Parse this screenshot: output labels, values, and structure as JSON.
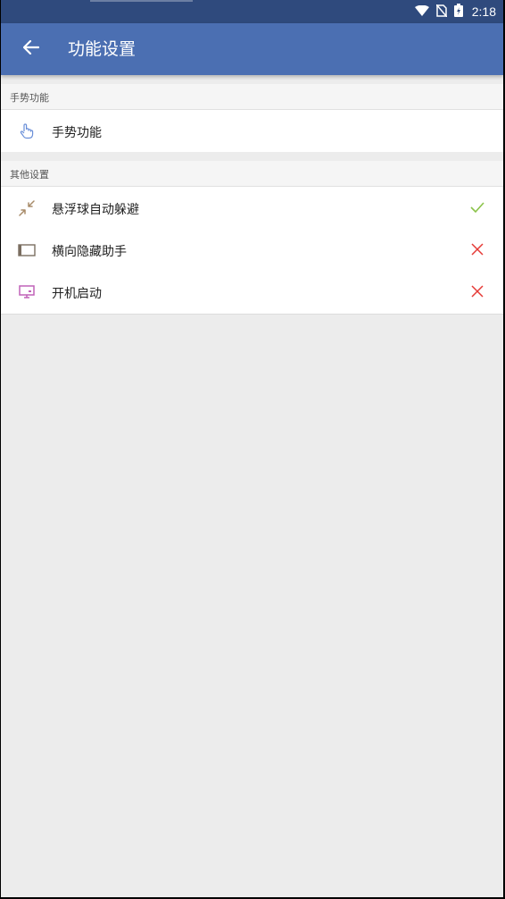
{
  "status_bar": {
    "time": "2:18"
  },
  "app_bar": {
    "title": "功能设置"
  },
  "sections": [
    {
      "header": "手势功能",
      "items": [
        {
          "label": "手势功能",
          "icon": "hand-pointer-icon"
        }
      ]
    },
    {
      "header": "其他设置",
      "items": [
        {
          "label": "悬浮球自动躲避",
          "icon": "shrink-arrows-icon",
          "status": "enabled",
          "status_icon": "check-icon"
        },
        {
          "label": "横向隐藏助手",
          "icon": "side-bar-icon",
          "status": "disabled",
          "status_icon": "cross-icon"
        },
        {
          "label": "开机启动",
          "icon": "monitor-icon",
          "status": "disabled",
          "status_icon": "cross-icon"
        }
      ]
    }
  ],
  "colors": {
    "app_bar": "#4b6fb2",
    "status_bar": "#2f4a7d",
    "check": "#8bc34a",
    "cross": "#e53935"
  }
}
